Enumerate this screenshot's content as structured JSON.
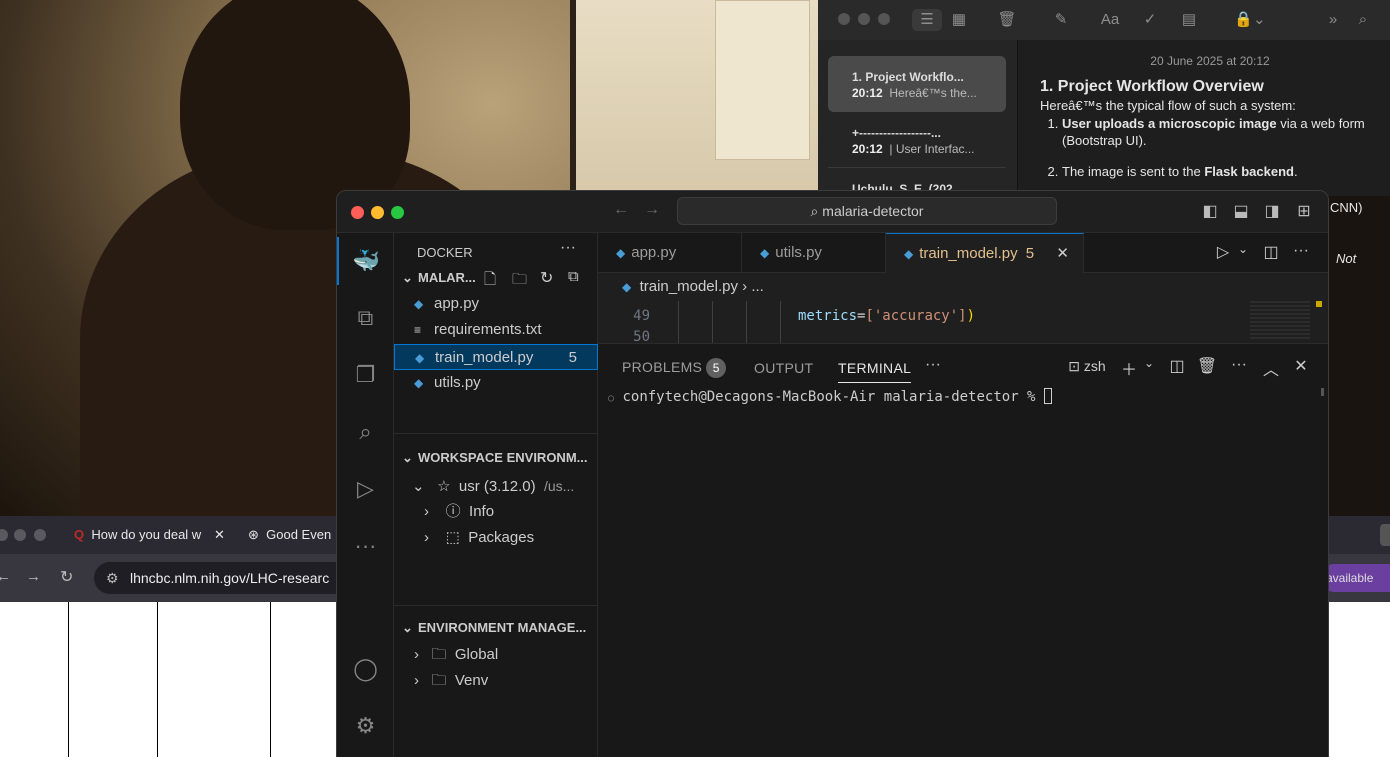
{
  "notes": {
    "list": [
      {
        "title": "1. Project Workflo...",
        "time": "20:12",
        "snippet": "Hereâ€™s the..."
      },
      {
        "title": "+------------------...",
        "time": "20:12",
        "snippet": "| User Interfac..."
      },
      {
        "title": "Uchulu, S. E. (202",
        "time": "",
        "snippet": ""
      }
    ],
    "date": "20 June 2025 at 20:12",
    "heading": "1. Project Workflow Overview",
    "intro": "Hereâ€™s the typical flow of such a system:",
    "steps": [
      {
        "bold": "User uploads a microscopic image",
        "rest": " via a web form (Bootstrap UI)."
      },
      {
        "pre": "The image is sent to the ",
        "bold": "Flask backend",
        "rest": "."
      }
    ],
    "peek_right": "CNN)",
    "peek_not": "Not"
  },
  "browser": {
    "tabs": [
      {
        "label": "How do you deal w"
      },
      {
        "label": "Good Even"
      }
    ],
    "url": "lhncbc.nlm.nih.gov/LHC-researc",
    "available": "available"
  },
  "vscode": {
    "search": "malaria-detector",
    "sidebar": {
      "title": "DOCKER",
      "folder": "MALAR...",
      "files": [
        {
          "name": "app.py",
          "type": "py",
          "badge": ""
        },
        {
          "name": "requirements.txt",
          "type": "txt",
          "badge": ""
        },
        {
          "name": "train_model.py",
          "type": "py",
          "badge": "5"
        },
        {
          "name": "utils.py",
          "type": "py",
          "badge": ""
        }
      ],
      "workspace_env": "WORKSPACE ENVIRONM...",
      "env_name": "usr (3.12.0)",
      "env_path": "/us...",
      "info": "Info",
      "packages": "Packages",
      "env_manage": "ENVIRONMENT MANAGE...",
      "global": "Global",
      "venv": "Venv"
    },
    "tabs": [
      {
        "label": "app.py"
      },
      {
        "label": "utils.py"
      },
      {
        "label": "train_model.py",
        "badge": "5"
      }
    ],
    "breadcrumb": "train_model.py",
    "breadcrumb_more": "...",
    "code": {
      "line1": "49",
      "line2": "50",
      "keyword": "metrics",
      "value": "['accuracy']"
    },
    "panel": {
      "problems": "PROBLEMS",
      "problems_count": "5",
      "output": "OUTPUT",
      "terminal": "TERMINAL",
      "shell": "zsh",
      "prompt": "confytech@Decagons-MacBook-Air malaria-detector % "
    }
  }
}
